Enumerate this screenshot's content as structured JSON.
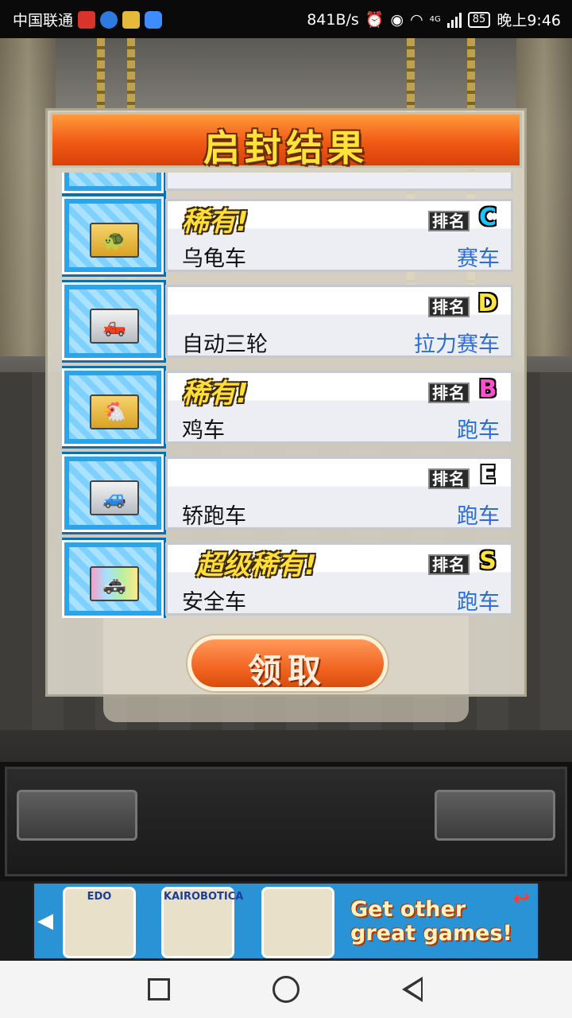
{
  "status_bar": {
    "carrier": "中国联通",
    "net_speed": "841B/s",
    "network": "4G",
    "battery": "85",
    "time": "晚上9:46"
  },
  "dialog": {
    "title": "启封结果",
    "claim_button": "领取",
    "rank_label": "排名",
    "items": [
      {
        "rarity": "",
        "name": "",
        "type": "",
        "rank": "",
        "box": "gold"
      },
      {
        "rarity": "稀有!",
        "name": "乌龟车",
        "type": "赛车",
        "rank": "C",
        "rank_color": "#19c6ff",
        "box": "gold",
        "icon": "turtle-car-icon"
      },
      {
        "rarity": "",
        "name": "自动三轮",
        "type": "拉力赛车",
        "rank": "D",
        "rank_color": "#ffe23a",
        "box": "silver",
        "icon": "tricycle-icon"
      },
      {
        "rarity": "稀有!",
        "name": "鸡车",
        "type": "跑车",
        "rank": "B",
        "rank_color": "#ff4fd0",
        "box": "gold",
        "icon": "chicken-car-icon"
      },
      {
        "rarity": "",
        "name": "轿跑车",
        "type": "跑车",
        "rank": "E",
        "rank_color": "#ffffff",
        "box": "silver",
        "icon": "coupe-icon"
      },
      {
        "rarity": "超级稀有!",
        "name": "安全车",
        "type": "跑车",
        "rank": "S",
        "rank_color": "#ffe23a",
        "box": "rainbow",
        "icon": "safety-car-icon"
      }
    ]
  },
  "ad": {
    "games": [
      "EDO",
      "KAIROBOTICA",
      ""
    ],
    "tagline_line1": "Get other",
    "tagline_line2": "great games!"
  },
  "colors": {
    "header_orange": "#f05a14",
    "title_yellow": "#ffe23a",
    "type_blue": "#2b6fd6",
    "ad_blue": "#2a93d6"
  }
}
